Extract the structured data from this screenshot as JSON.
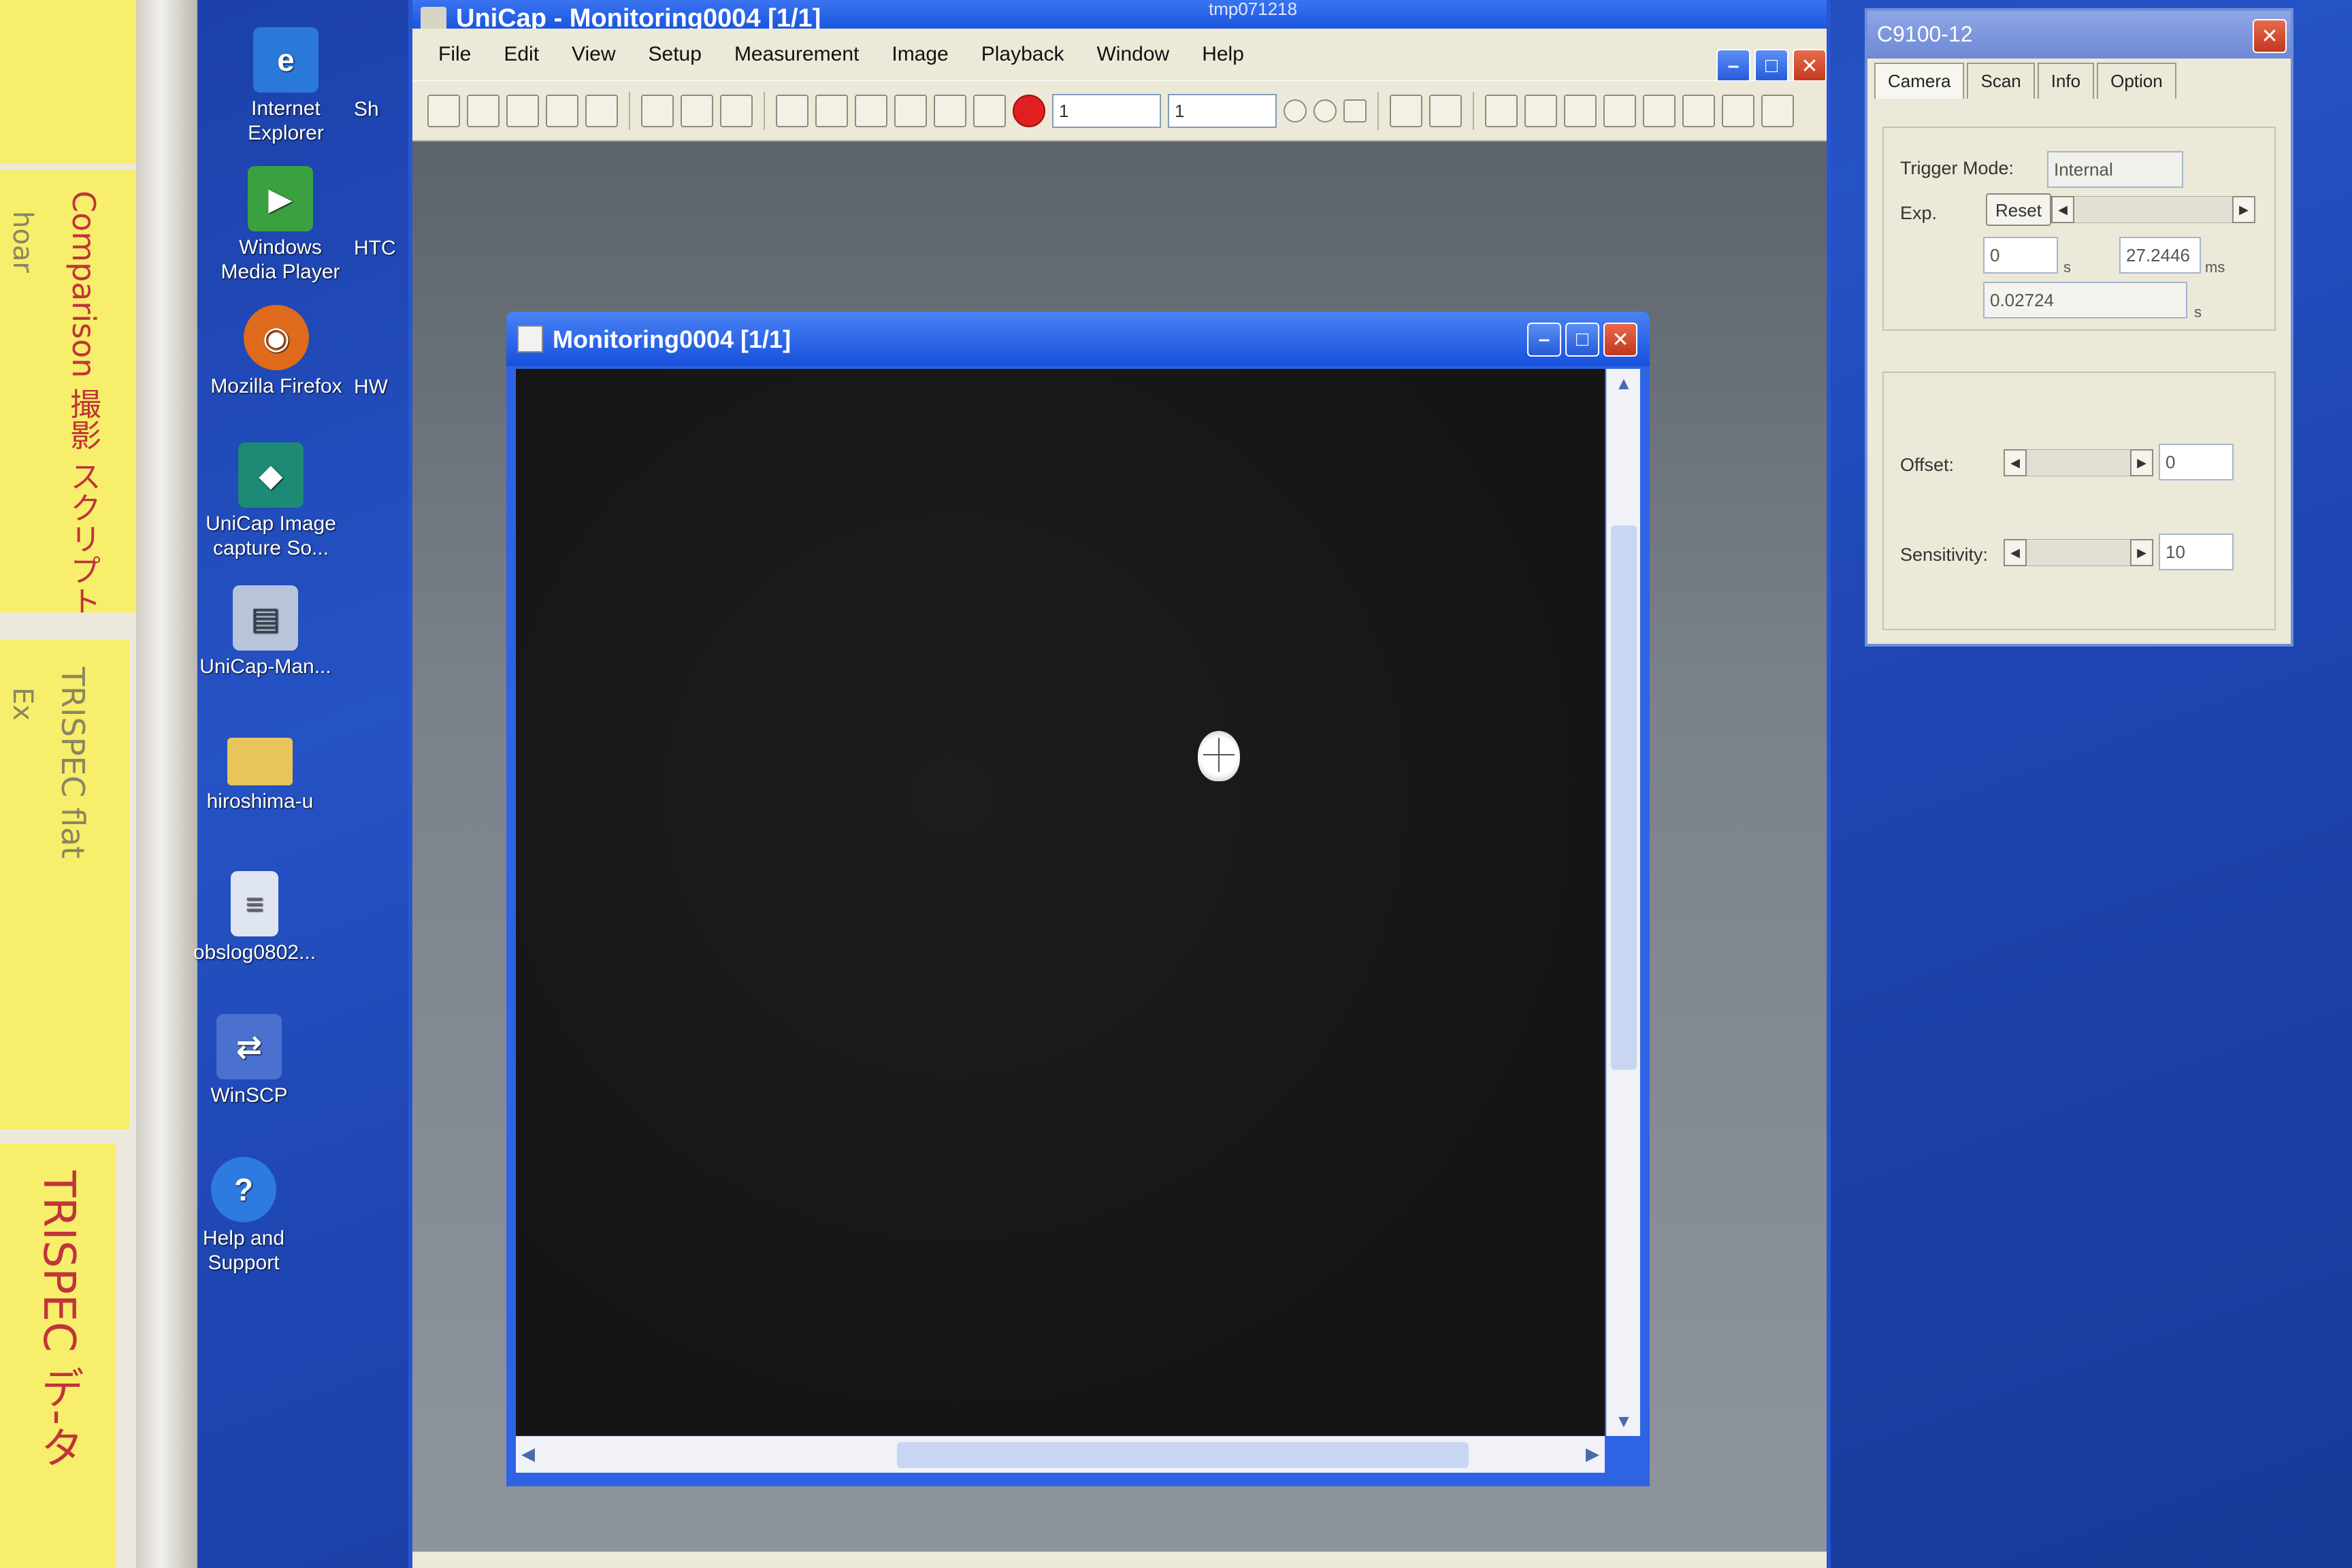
{
  "desktop": {
    "icons": [
      {
        "label1": "Internet",
        "label2": "Explorer",
        "glyph": "e",
        "color": "#2a78d8",
        "icon": "internet-explorer-icon"
      },
      {
        "label1": "Windows",
        "label2": "Media Player",
        "glyph": "▶",
        "color": "#3aa040",
        "icon": "media-player-icon"
      },
      {
        "label1": "Mozilla Firefox",
        "label2": "",
        "glyph": "◉",
        "color": "#e06a1c",
        "icon": "firefox-icon"
      },
      {
        "label1": "UniCap Image",
        "label2": "capture So...",
        "glyph": "◆",
        "color": "#1c8a74",
        "icon": "unicap-capture-icon"
      },
      {
        "label1": "UniCap-Man...",
        "label2": "",
        "glyph": "▤",
        "color": "#b8c4da",
        "icon": "unicap-manual-icon"
      },
      {
        "label1": "hiroshima-u",
        "label2": "",
        "glyph": "",
        "color": "#e8c45a",
        "icon": "folder-icon"
      },
      {
        "label1": "obslog0802...",
        "label2": "",
        "glyph": "≡",
        "color": "#dfe6f0",
        "icon": "text-file-icon"
      },
      {
        "label1": "WinSCP",
        "label2": "",
        "glyph": "⇄",
        "color": "#4a70d0",
        "icon": "winscp-icon"
      },
      {
        "label1": "Help and",
        "label2": "Support",
        "glyph": "?",
        "color": "#2d7ae0",
        "icon": "help-icon"
      }
    ],
    "edge_labels": [
      "Sh",
      "HTC",
      "HW"
    ]
  },
  "sticky_notes": [
    {
      "text": "Comparison 撮影 スクリプト",
      "extra": "hoar"
    },
    {
      "text": "TRISPEC flat",
      "extra": "Ex"
    },
    {
      "text": "TRISPEC デ-タ",
      "extra": ""
    }
  ],
  "app": {
    "title": "UniCap - Monitoring0004 [1/1]",
    "title_extra": "tmp071218",
    "menu": [
      "File",
      "Edit",
      "View",
      "Setup",
      "Measurement",
      "Image",
      "Playback",
      "Window",
      "Help"
    ],
    "field1": "1",
    "field2": "1"
  },
  "child": {
    "title": "Monitoring0004 [1/1]"
  },
  "panel": {
    "title": "C9100-12",
    "tabs": [
      "Camera",
      "Scan",
      "Info",
      "Option"
    ],
    "active_tab": "Camera",
    "trigger_label": "Trigger Mode:",
    "trigger_value": "Internal",
    "exp_label": "Exp.",
    "reset_label": "Reset",
    "exp_seconds": "0",
    "exp_seconds_unit": "s",
    "exp_ms": "27.2446",
    "exp_ms_unit": "ms",
    "exp_total": "0.02724",
    "exp_total_unit": "s",
    "offset_label": "Offset:",
    "offset_value": "0",
    "sensitivity_label": "Sensitivity:",
    "sensitivity_value": "10"
  }
}
